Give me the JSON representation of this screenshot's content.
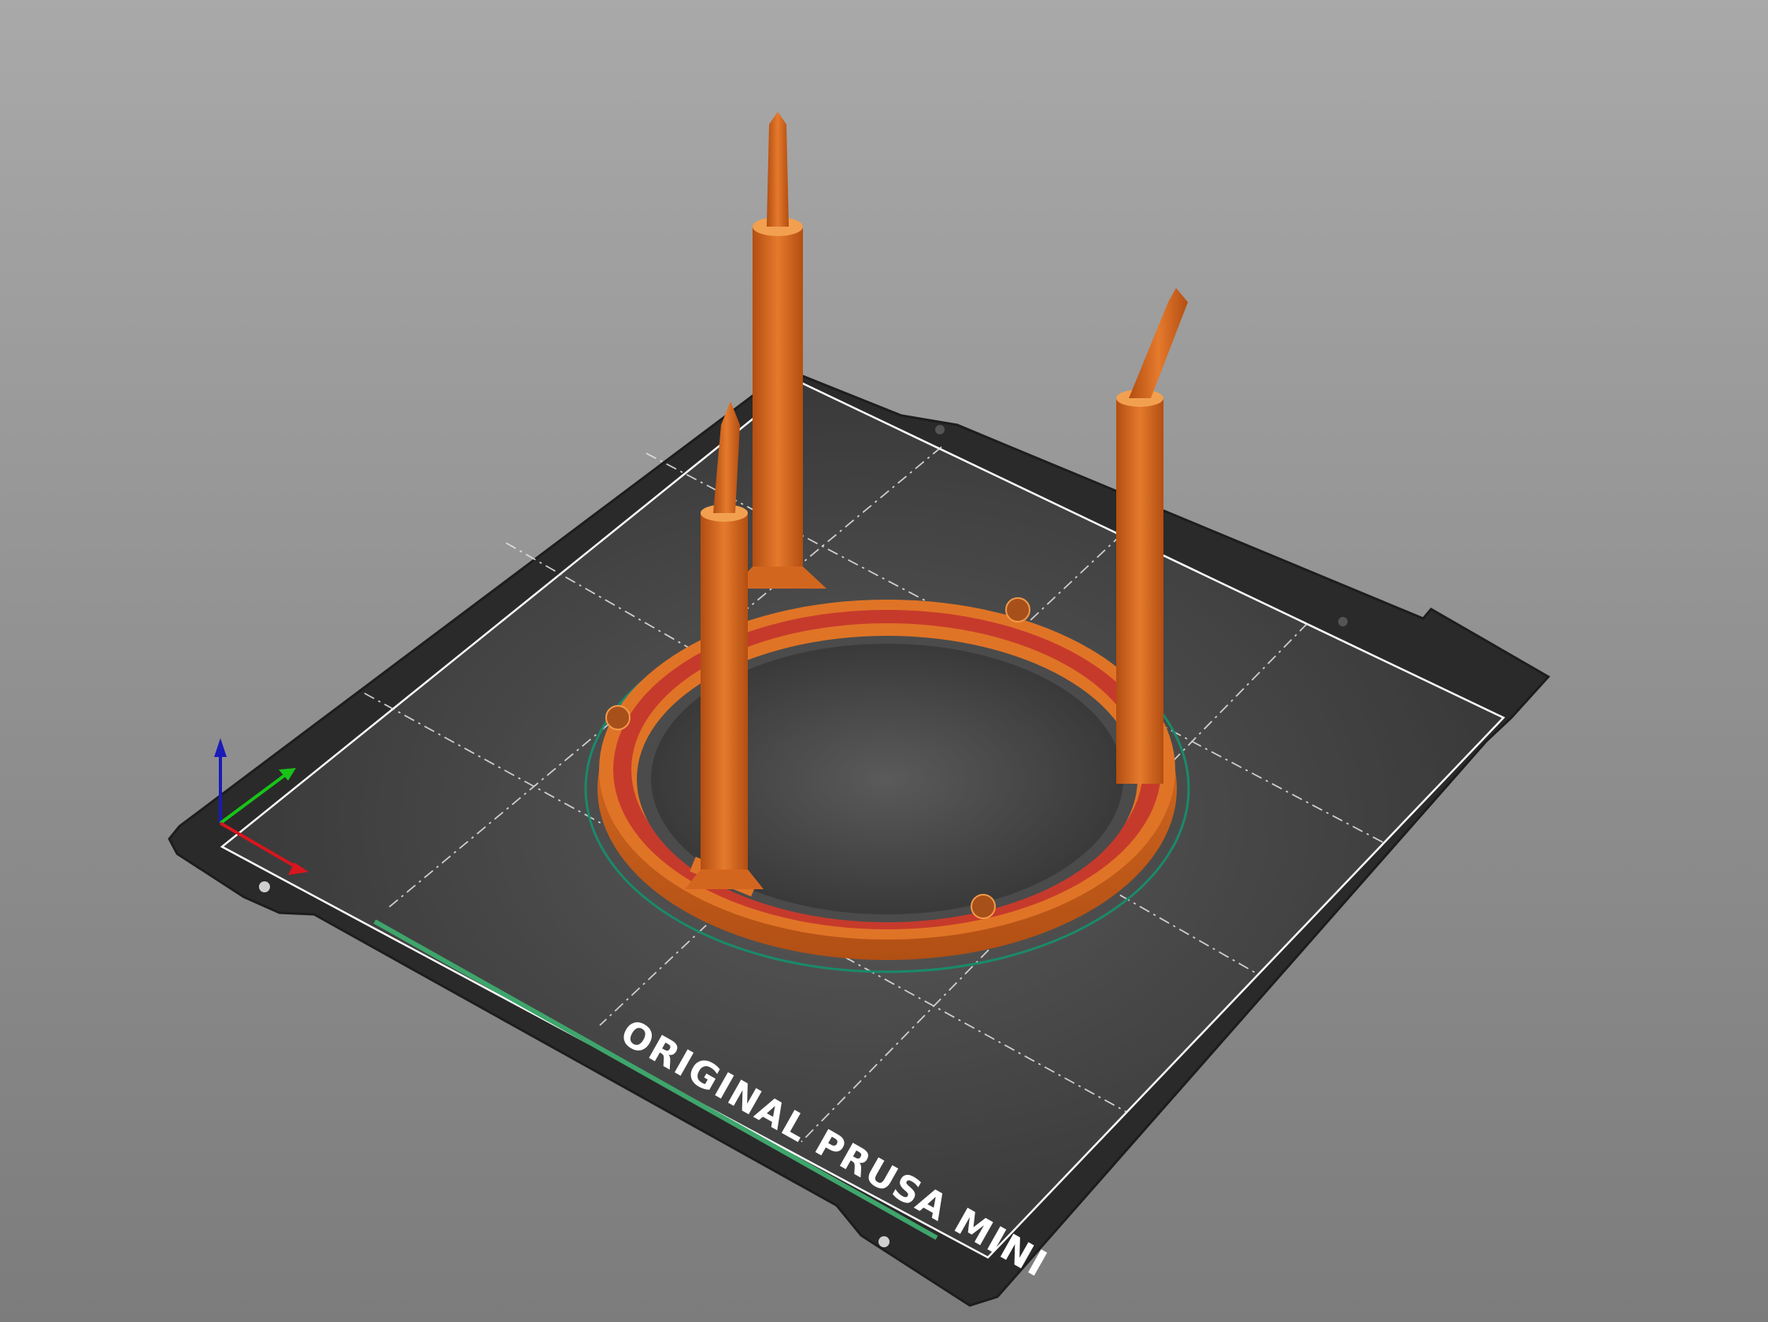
{
  "viewport": {
    "background_top": "#a9a9a9",
    "background_bottom": "#7c7c7c"
  },
  "bed": {
    "label": "ORIGINAL PRUSA MINI",
    "sheet_color": "#262626",
    "surface_color": "#3b3b3b",
    "grid": "dashed",
    "accent_stripe_color": "#3fa56c"
  },
  "model": {
    "color": "#d9661f",
    "top_layer_color": "#c63a2c",
    "outline_color": "#1a8a6a"
  },
  "axes": {
    "x_color": "#d8161d",
    "y_color": "#18c418",
    "z_color": "#1a1ab8"
  }
}
